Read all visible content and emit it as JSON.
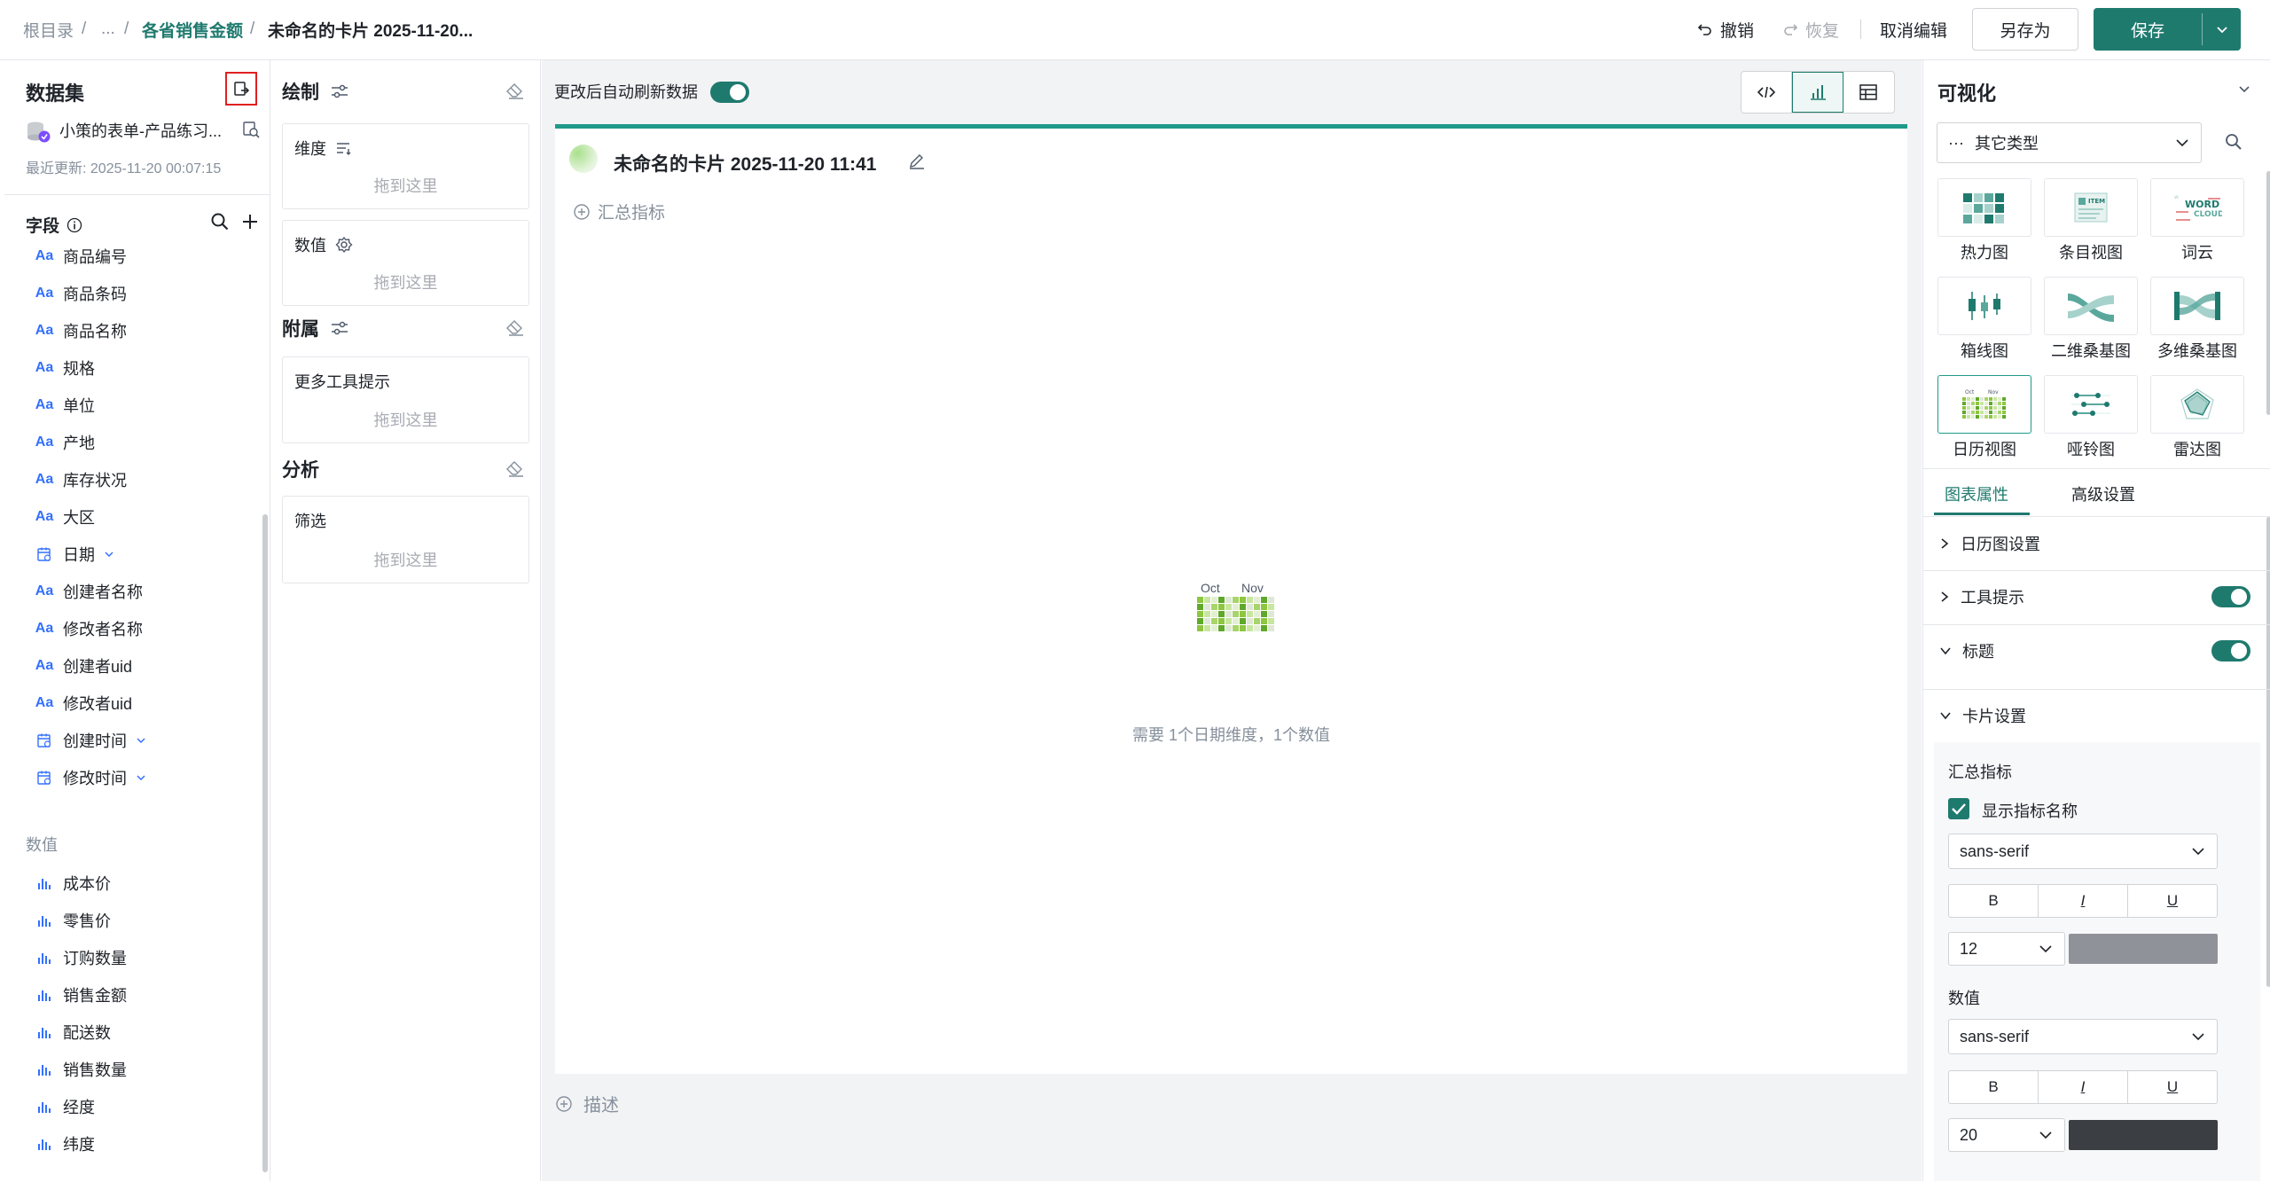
{
  "breadcrumb": {
    "root": "根目录",
    "sep": "/",
    "ellipsis": "...",
    "parent": "各省销售金额",
    "current": "未命名的卡片 2025-11-20..."
  },
  "toolbar": {
    "undo": "撤销",
    "redo": "恢复",
    "cancel_edit": "取消编辑",
    "save_as": "另存为",
    "save": "保存"
  },
  "dataset": {
    "title": "数据集",
    "name": "小策的表单-产品练习...",
    "updated": "最近更新: 2025-11-20 00:07:15"
  },
  "fields": {
    "title": "字段",
    "dim_items": [
      {
        "icon": "text",
        "label": "商品编号"
      },
      {
        "icon": "text",
        "label": "商品条码"
      },
      {
        "icon": "text",
        "label": "商品名称"
      },
      {
        "icon": "text",
        "label": "规格"
      },
      {
        "icon": "text",
        "label": "单位"
      },
      {
        "icon": "text",
        "label": "产地"
      },
      {
        "icon": "text",
        "label": "库存状况"
      },
      {
        "icon": "text",
        "label": "大区"
      },
      {
        "icon": "date",
        "label": "日期"
      },
      {
        "icon": "text",
        "label": "创建者名称"
      },
      {
        "icon": "text",
        "label": "修改者名称"
      },
      {
        "icon": "text",
        "label": "创建者uid"
      },
      {
        "icon": "text",
        "label": "修改者uid"
      },
      {
        "icon": "date",
        "label": "创建时间"
      },
      {
        "icon": "date",
        "label": "修改时间"
      }
    ],
    "measure_title": "数值",
    "measure_items": [
      "成本价",
      "零售价",
      "订购数量",
      "销售金额",
      "配送数",
      "销售数量",
      "经度",
      "纬度"
    ],
    "text_icon_glyph": "Aa"
  },
  "draw": {
    "title": "绘制",
    "dimension": "维度",
    "measure": "数值",
    "drop_hint": "拖到这里"
  },
  "attach": {
    "title": "附属",
    "tooltip": "更多工具提示",
    "drop_hint": "拖到这里"
  },
  "analysis": {
    "title": "分析",
    "filter": "筛选",
    "drop_hint": "拖到这里"
  },
  "canvas": {
    "auto_refresh": "更改后自动刷新数据",
    "card_title": "未命名的卡片 2025-11-20 11:41",
    "summary": "汇总指标",
    "hint": "需要 1个日期维度，1个数值",
    "month1": "Oct",
    "month2": "Nov",
    "desc": "描述"
  },
  "viz": {
    "title": "可视化",
    "type_select": "其它类型",
    "types": [
      "热力图",
      "条目视图",
      "词云",
      "箱线图",
      "二维桑基图",
      "多维桑基图",
      "日历视图",
      "哑铃图",
      "雷达图"
    ],
    "item_text": "ITEM",
    "word_text": "WORD",
    "cloud_text": "CLOUD",
    "tabs": [
      "图表属性",
      "高级设置"
    ],
    "calendar_settings": "日历图设置",
    "tooltip": "工具提示",
    "title_opt": "标题",
    "card_settings": "卡片设置",
    "summary_label": "汇总指标",
    "show_name": "显示指标名称",
    "font1": "sans-serif",
    "size1": "12",
    "value_label": "数值",
    "font2": "sans-serif",
    "size2": "20",
    "bold": "B",
    "italic": "I",
    "underline": "U",
    "color1": "#8f9399",
    "color2": "#3b3f44"
  },
  "colors": {
    "accent": "#1f7a6e",
    "calendar_green": "#8dc63f"
  }
}
